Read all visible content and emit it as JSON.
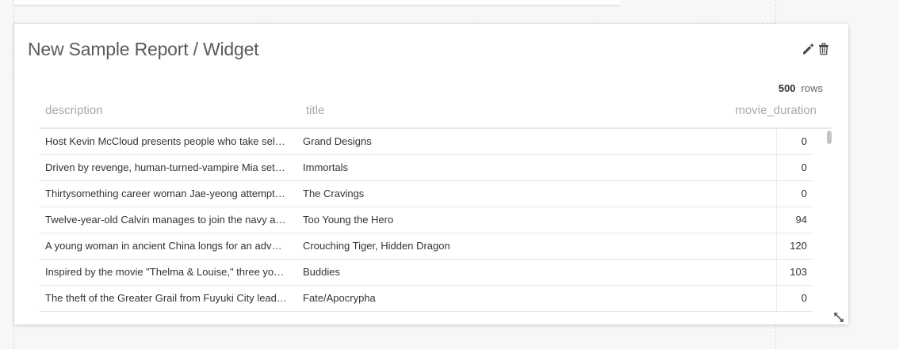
{
  "widget": {
    "title": "New Sample Report / Widget",
    "row_count": "500",
    "row_count_label": "rows"
  },
  "table": {
    "columns": [
      "description",
      "title",
      "movie_duration"
    ],
    "rows": [
      {
        "description": "Host Kevin McCloud presents people who take sel…",
        "title": "Grand Designs",
        "movie_duration": "0"
      },
      {
        "description": "Driven by revenge, human-turned-vampire Mia set…",
        "title": "Immortals",
        "movie_duration": "0"
      },
      {
        "description": "Thirtysomething career woman Jae-yeong attempt…",
        "title": "The Cravings",
        "movie_duration": "0"
      },
      {
        "description": "Twelve-year-old Calvin manages to join the navy a…",
        "title": "Too Young the Hero",
        "movie_duration": "94"
      },
      {
        "description": "A young woman in ancient China longs for an adv…",
        "title": "Crouching Tiger, Hidden Dragon",
        "movie_duration": "120"
      },
      {
        "description": "Inspired by the movie \"Thelma & Louise,\" three yo…",
        "title": "Buddies",
        "movie_duration": "103"
      },
      {
        "description": "The theft of the Greater Grail from Fuyuki City lead…",
        "title": "Fate/Apocrypha",
        "movie_duration": "0"
      }
    ]
  },
  "icons": {
    "edit": "pencil-icon",
    "delete": "trash-icon",
    "resize": "resize-arrows-icon"
  },
  "colors": {
    "title_text": "#5b5b5b",
    "header_text": "#a8a8a8",
    "body_text": "#333333",
    "icon": "#4a4a4a"
  }
}
